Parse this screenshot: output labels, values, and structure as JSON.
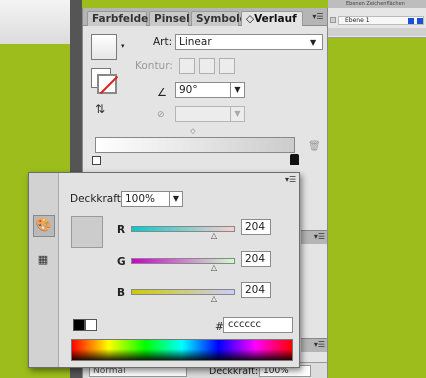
{
  "layers_panel": {
    "tabs_text": "Ebenen  Zeichenflächen",
    "layer_name": "Ebene 1",
    "accent_color": "#1a4fd6"
  },
  "gradient_panel": {
    "tabs": [
      "Farbfelder",
      "Pinsel",
      "Symbole",
      "◇Verlauf"
    ],
    "active_tab": "◇Verlauf",
    "art_label": "Art:",
    "art_value": "Linear",
    "kontur_label": "Kontur:",
    "angle_value": "90°",
    "gradient_colors": [
      "#ffffff",
      "#cccccc"
    ],
    "bottom_blend": "Normal",
    "bottom_label": "Deckkraft:",
    "bottom_value": "100%"
  },
  "color_popup": {
    "opacity_label": "Deckkraft:",
    "opacity_value": "100%",
    "preview_color": "#cccccc",
    "channels": [
      {
        "label": "R",
        "value": "204"
      },
      {
        "label": "G",
        "value": "204"
      },
      {
        "label": "B",
        "value": "204"
      }
    ],
    "hex_label": "#",
    "hex_value": "cccccc"
  },
  "colors": {
    "background_green": "#9dbd1c",
    "panel_gray": "#e4e4e4"
  }
}
